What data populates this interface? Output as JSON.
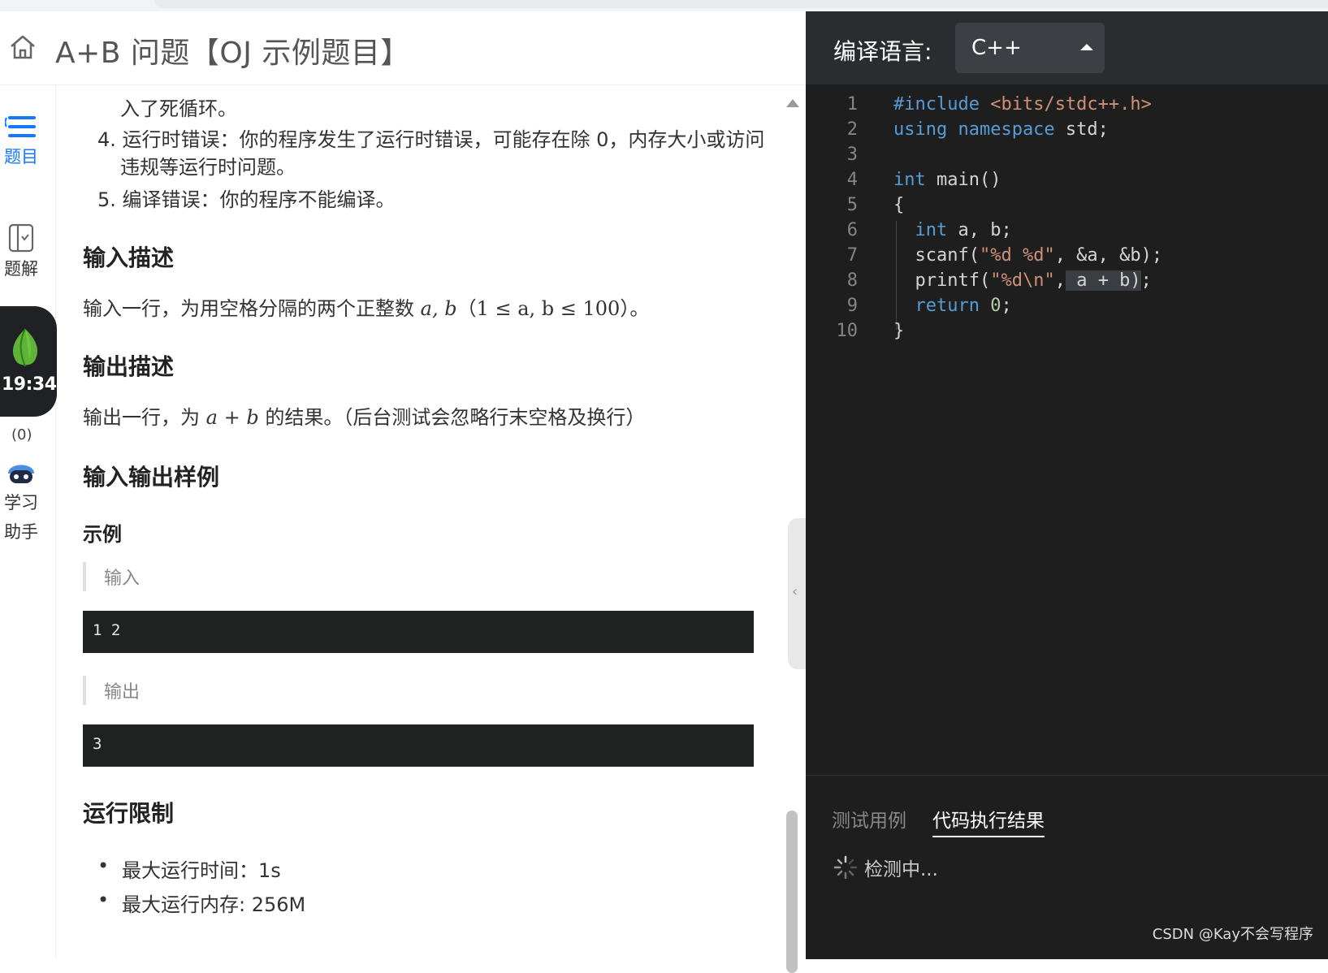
{
  "header": {
    "title": "A+B 问题【OJ 示例题目】"
  },
  "sidebar": {
    "items": [
      {
        "label": "题目",
        "icon": "list-icon",
        "active": true
      },
      {
        "label": "题解",
        "icon": "solution-book-icon",
        "active": false
      },
      {
        "label": "学习",
        "label2": "助手",
        "icon": "robot-assistant-icon",
        "active": false
      }
    ],
    "timer": "19:34",
    "timer_count": "(0)"
  },
  "content": {
    "frag_prev": "入了死循环。",
    "item4_line1": "4. 运行时错误：你的程序发生了运行时错误，可能存在除 0，内存大小或访问",
    "item4_line2": "违规等运行时问题。",
    "item5": "5. 编译错误：你的程序不能编译。",
    "input_title": "输入描述",
    "input_desc_text": "输入一行，为用空格分隔的两个正整数 ",
    "input_desc_math": "a, b",
    "input_desc_range_open": "（",
    "input_desc_range": "1 ≤ a, b ≤ 100",
    "input_desc_range_close": "）。",
    "output_title": "输出描述",
    "output_desc_text": "输出一行，为 ",
    "output_desc_math": "a + b",
    "output_desc_rest": " 的结果。（后台测试会忽略行末空格及换行）",
    "samples_title": "输入输出样例",
    "example_title": "示例",
    "input_label": "输入",
    "input_value": "1 2",
    "output_label": "输出",
    "output_value": "3",
    "limits_title": "运行限制",
    "limits": [
      "最大运行时间：1s",
      "最大运行内存: 256M"
    ]
  },
  "editor": {
    "lang_label": "编译语言:",
    "lang_value": "C++",
    "line_numbers": [
      "1",
      "2",
      "3",
      "4",
      "5",
      "6",
      "7",
      "8",
      "9",
      "10"
    ]
  },
  "bottom": {
    "tab_test": "测试用例",
    "tab_result": "代码执行结果",
    "status": "检测中..."
  },
  "watermark": "CSDN @Kay不会写程序",
  "colors": {
    "accent_blue": "#1677ff",
    "editor_bg": "#1e1e1e",
    "editor_header_bg": "#2a2d30",
    "keyword": "#569cd6",
    "string": "#ce9178"
  }
}
